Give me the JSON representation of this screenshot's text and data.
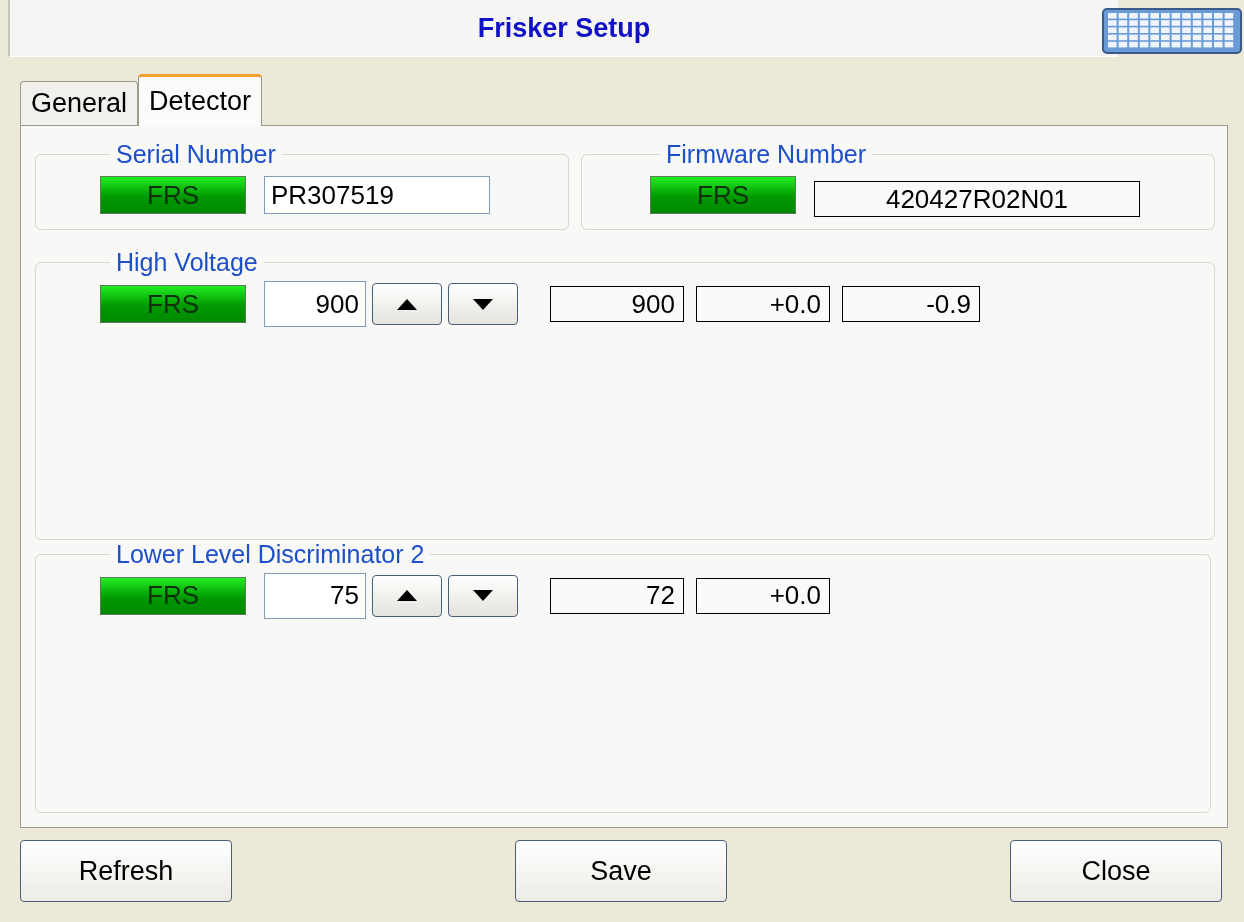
{
  "window": {
    "title": "Frisker Setup"
  },
  "tabs": [
    {
      "label": "General",
      "selected": false
    },
    {
      "label": "Detector",
      "selected": true
    }
  ],
  "top_groups": [
    {
      "legend": "Serial Number",
      "indicator": "FRS",
      "field": {
        "kind": "input",
        "value": "PR307519"
      }
    },
    {
      "legend": "Firmware Number",
      "indicator": "FRS",
      "field": {
        "kind": "readout",
        "value": "420427R02N01"
      }
    }
  ],
  "spin_groups": [
    {
      "legend": "High Voltage",
      "indicator": "FRS",
      "value": "900",
      "readouts": [
        "900",
        "+0.0",
        "-0.9"
      ]
    },
    {
      "legend": "Lower Level Discriminator 2",
      "indicator": "FRS",
      "value": "75",
      "readouts": [
        "72",
        "+0.0"
      ]
    }
  ],
  "buttons": [
    "Refresh",
    "Save",
    "Close"
  ]
}
